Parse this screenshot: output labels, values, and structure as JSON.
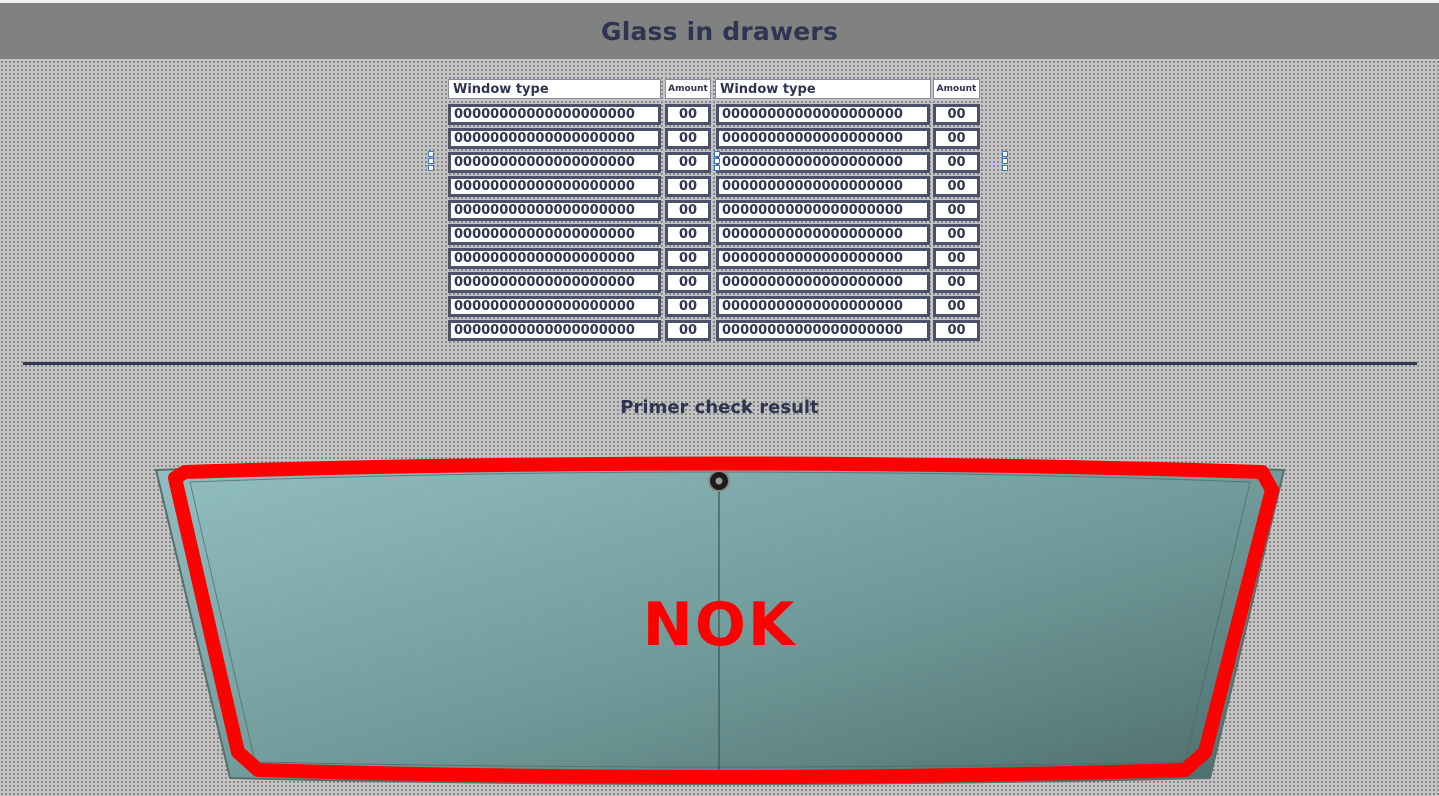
{
  "header": {
    "title": "Glass in drawers"
  },
  "drawers": {
    "columns": [
      {
        "window_type_header": "Window type",
        "amount_header": "Amount"
      },
      {
        "window_type_header": "Window type",
        "amount_header": "Amount"
      }
    ],
    "left_rows": [
      {
        "window_type": "00000000000000000000",
        "amount": "00"
      },
      {
        "window_type": "00000000000000000000",
        "amount": "00"
      },
      {
        "window_type": "00000000000000000000",
        "amount": "00"
      },
      {
        "window_type": "00000000000000000000",
        "amount": "00"
      },
      {
        "window_type": "00000000000000000000",
        "amount": "00"
      },
      {
        "window_type": "00000000000000000000",
        "amount": "00"
      },
      {
        "window_type": "00000000000000000000",
        "amount": "00"
      },
      {
        "window_type": "00000000000000000000",
        "amount": "00"
      },
      {
        "window_type": "00000000000000000000",
        "amount": "00"
      },
      {
        "window_type": "00000000000000000000",
        "amount": "00"
      }
    ],
    "right_rows": [
      {
        "window_type": "00000000000000000000",
        "amount": "00"
      },
      {
        "window_type": "00000000000000000000",
        "amount": "00"
      },
      {
        "window_type": "00000000000000000000",
        "amount": "00"
      },
      {
        "window_type": "00000000000000000000",
        "amount": "00"
      },
      {
        "window_type": "00000000000000000000",
        "amount": "00"
      },
      {
        "window_type": "00000000000000000000",
        "amount": "00"
      },
      {
        "window_type": "00000000000000000000",
        "amount": "00"
      },
      {
        "window_type": "00000000000000000000",
        "amount": "00"
      },
      {
        "window_type": "00000000000000000000",
        "amount": "00"
      },
      {
        "window_type": "00000000000000000000",
        "amount": "00"
      }
    ]
  },
  "primer": {
    "title": "Primer check result",
    "result": "NOK",
    "result_color": "#ff0000",
    "glass_color": "#7fa5a6",
    "outline_color": "#ff0000"
  },
  "colors": {
    "header_bg": "#818181",
    "text_dark": "#2f3450",
    "cell_border": "#4c5068"
  }
}
